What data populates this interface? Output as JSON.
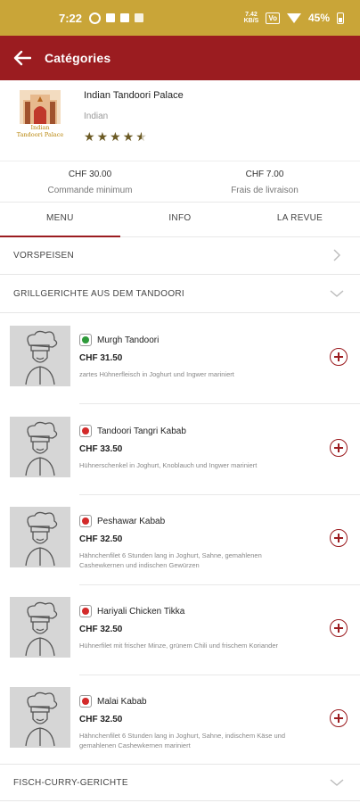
{
  "status_bar": {
    "time": "7:22",
    "net_speed_top": "7.42",
    "net_speed_bottom": "KB/S",
    "vol_badge": "Vo",
    "battery": "45%"
  },
  "app_bar": {
    "title": "Catégories"
  },
  "restaurant": {
    "name": "Indian Tandoori Palace",
    "cuisine": "Indian",
    "logo_line1": "Indian",
    "logo_line2": "Tandoori Palace",
    "rating": 4.5
  },
  "stats": {
    "min_order_value": "CHF 30.00",
    "min_order_label": "Commande minimum",
    "delivery_value": "CHF 7.00",
    "delivery_label": "Frais de livraison"
  },
  "tabs": [
    {
      "label": "MENU",
      "active": true
    },
    {
      "label": "INFO",
      "active": false
    },
    {
      "label": "LA REVUE",
      "active": false
    }
  ],
  "categories": {
    "vorspeisen": "VORSPEISEN",
    "grill": "GRILLGERICHTE AUS DEM TANDOORI",
    "fisch": "FISCH-CURRY-GERICHTE"
  },
  "items": [
    {
      "name": "Murgh Tandoori",
      "price": "CHF 31.50",
      "desc": "zartes Hühnerfleisch in Joghurt und Ingwer mariniert",
      "type": "veg"
    },
    {
      "name": "Tandoori Tangri Kabab",
      "price": "CHF 33.50",
      "desc": "Hühnerschenkel in Joghurt, Knoblauch und Ingwer mariniert",
      "type": "nonveg"
    },
    {
      "name": "Peshawar Kabab",
      "price": "CHF 32.50",
      "desc": "Hähnchenfilet 6 Stunden lang in Joghurt, Sahne, gemahlenen Cashewkernen und indischen Gewürzen",
      "type": "nonveg"
    },
    {
      "name": "Hariyali Chicken Tikka",
      "price": "CHF 32.50",
      "desc": "Hühnerfilet mit frischer Minze, grünem Chili und frischem Koriander",
      "type": "nonveg"
    },
    {
      "name": "Malai Kabab",
      "price": "CHF 32.50",
      "desc": "Hähnchenfilet 6 Stunden lang in Joghurt, Sahne, indischem Käse und gemahlenen Cashewkernen mariniert",
      "type": "nonveg"
    }
  ],
  "colors": {
    "status_bar": "#c9a538",
    "brand": "#9b1c20",
    "veg": "#2e9a3a",
    "nonveg": "#d32a2a"
  }
}
